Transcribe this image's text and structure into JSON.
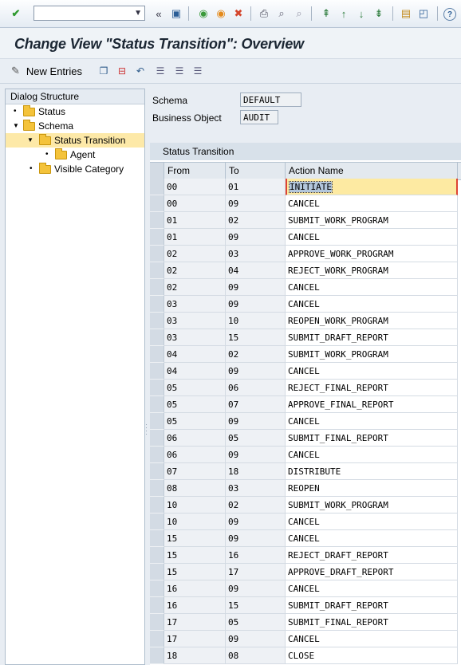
{
  "toolbar": {
    "command_value": "",
    "icons": [
      "enter-icon",
      "back-icon",
      "save-icon",
      "back-nav-icon",
      "exit-icon",
      "cancel-icon",
      "print-icon",
      "find-icon",
      "find-next-icon",
      "first-page-icon",
      "previous-page-icon",
      "next-page-icon",
      "last-page-icon",
      "new-session-icon",
      "shortcut-icon",
      "help-icon"
    ]
  },
  "title": "Change View \"Status Transition\": Overview",
  "app_toolbar": {
    "new_entries_label": "New Entries"
  },
  "dialog_structure": {
    "header": "Dialog Structure",
    "items": [
      {
        "label": "Status"
      },
      {
        "label": "Schema"
      },
      {
        "label": "Status Transition"
      },
      {
        "label": "Agent"
      },
      {
        "label": "Visible Category"
      }
    ]
  },
  "header_fields": {
    "schema_label": "Schema",
    "schema_value": "DEFAULT",
    "business_object_label": "Business Object",
    "business_object_value": "AUDIT"
  },
  "table": {
    "title": "Status Transition",
    "columns": {
      "from": "From",
      "to": "To",
      "action": "Action Name"
    },
    "rows": [
      {
        "from": "00",
        "to": "01",
        "action": "INITIATE"
      },
      {
        "from": "00",
        "to": "09",
        "action": "CANCEL"
      },
      {
        "from": "01",
        "to": "02",
        "action": "SUBMIT_WORK_PROGRAM"
      },
      {
        "from": "01",
        "to": "09",
        "action": "CANCEL"
      },
      {
        "from": "02",
        "to": "03",
        "action": "APPROVE_WORK_PROGRAM"
      },
      {
        "from": "02",
        "to": "04",
        "action": "REJECT_WORK_PROGRAM"
      },
      {
        "from": "02",
        "to": "09",
        "action": "CANCEL"
      },
      {
        "from": "03",
        "to": "09",
        "action": "CANCEL"
      },
      {
        "from": "03",
        "to": "10",
        "action": "REOPEN_WORK_PROGRAM"
      },
      {
        "from": "03",
        "to": "15",
        "action": "SUBMIT_DRAFT_REPORT"
      },
      {
        "from": "04",
        "to": "02",
        "action": "SUBMIT_WORK_PROGRAM"
      },
      {
        "from": "04",
        "to": "09",
        "action": "CANCEL"
      },
      {
        "from": "05",
        "to": "06",
        "action": "REJECT_FINAL_REPORT"
      },
      {
        "from": "05",
        "to": "07",
        "action": "APPROVE_FINAL_REPORT"
      },
      {
        "from": "05",
        "to": "09",
        "action": "CANCEL"
      },
      {
        "from": "06",
        "to": "05",
        "action": "SUBMIT_FINAL_REPORT"
      },
      {
        "from": "06",
        "to": "09",
        "action": "CANCEL"
      },
      {
        "from": "07",
        "to": "18",
        "action": "DISTRIBUTE"
      },
      {
        "from": "08",
        "to": "03",
        "action": "REOPEN"
      },
      {
        "from": "10",
        "to": "02",
        "action": "SUBMIT_WORK_PROGRAM"
      },
      {
        "from": "10",
        "to": "09",
        "action": "CANCEL"
      },
      {
        "from": "15",
        "to": "09",
        "action": "CANCEL"
      },
      {
        "from": "15",
        "to": "16",
        "action": "REJECT_DRAFT_REPORT"
      },
      {
        "from": "15",
        "to": "17",
        "action": "APPROVE_DRAFT_REPORT"
      },
      {
        "from": "16",
        "to": "09",
        "action": "CANCEL"
      },
      {
        "from": "16",
        "to": "15",
        "action": "SUBMIT_DRAFT_REPORT"
      },
      {
        "from": "17",
        "to": "05",
        "action": "SUBMIT_FINAL_REPORT"
      },
      {
        "from": "17",
        "to": "09",
        "action": "CANCEL"
      },
      {
        "from": "18",
        "to": "08",
        "action": "CLOSE"
      }
    ]
  }
}
